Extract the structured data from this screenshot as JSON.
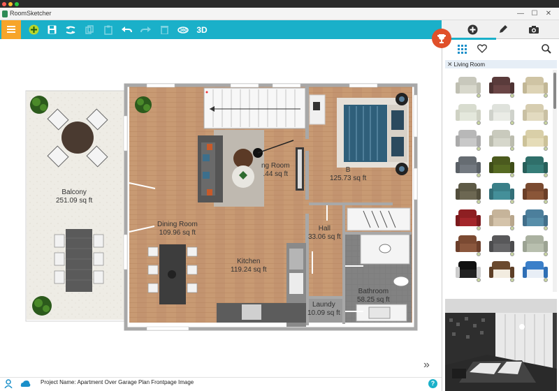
{
  "window": {
    "title": "RoomSketcher",
    "controls": [
      "—",
      "☐",
      "✕"
    ]
  },
  "toolbar": {
    "buttons": [
      {
        "name": "add",
        "glyph": "+"
      },
      {
        "name": "save",
        "glyph": "💾"
      },
      {
        "name": "settings",
        "glyph": "⇋"
      },
      {
        "name": "copy",
        "glyph": "⧉"
      },
      {
        "name": "paste",
        "glyph": "📋"
      },
      {
        "name": "undo",
        "glyph": "↶"
      },
      {
        "name": "redo",
        "glyph": "↷"
      },
      {
        "name": "delete",
        "glyph": "🗑"
      },
      {
        "name": "rotate-360",
        "glyph": "⟳"
      },
      {
        "name": "3d",
        "glyph": "3D"
      }
    ]
  },
  "panel": {
    "breadcrumb": "Living Room",
    "tabs": [
      "add",
      "edit",
      "camera"
    ]
  },
  "rooms": [
    {
      "name": "Balcony",
      "area": "251.09 sq ft"
    },
    {
      "name": "Dining Room",
      "area": "109.96 sq ft"
    },
    {
      "name": "ng Room",
      "area": ".44 sq ft"
    },
    {
      "name": "B",
      "area": "125.73 sq ft"
    },
    {
      "name": "Kitchen",
      "area": "119.24 sq ft"
    },
    {
      "name": "Hall",
      "area": "33.06 sq ft"
    },
    {
      "name": "Bathroom",
      "area": "58.25 sq ft"
    },
    {
      "name": "Laundy",
      "area": "10.09 sq ft"
    }
  ],
  "status": {
    "project_name": "Project Name: Apartment Over Garage Plan Frontpage Image"
  },
  "colors": {
    "toolbar": "#1ab0c9",
    "menu": "#f7a52a",
    "accent_red": "#e0502a",
    "floor_wood": "#c89a73",
    "balcony": "#eeece5"
  }
}
